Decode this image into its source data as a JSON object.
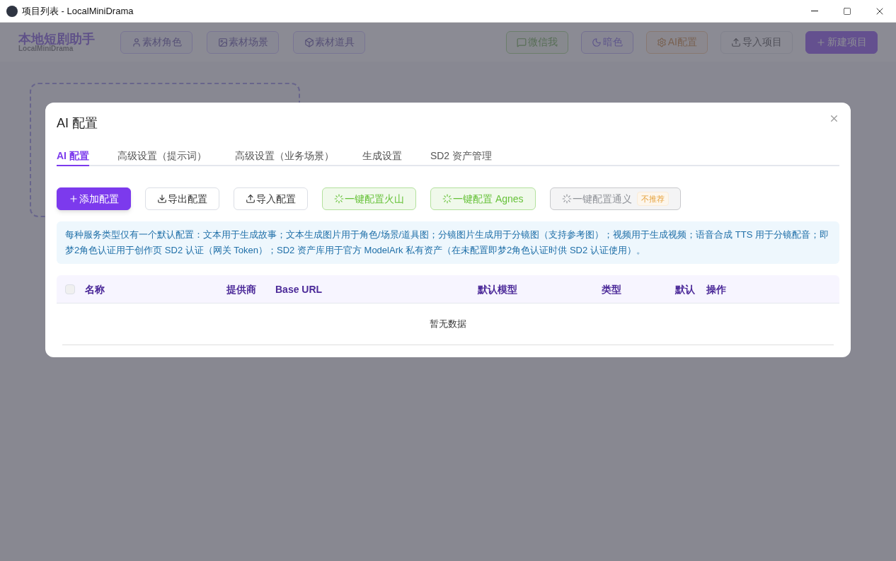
{
  "window": {
    "title": "项目列表 - LocalMiniDrama"
  },
  "header": {
    "logo": "本地短剧助手",
    "logo_sub": "LocalMiniDrama",
    "left_buttons": [
      {
        "label": "素材角色"
      },
      {
        "label": "素材场景"
      },
      {
        "label": "素材道具"
      }
    ],
    "right_buttons": [
      {
        "label": "微信我",
        "kind": "green"
      },
      {
        "label": "暗色",
        "kind": "purple"
      },
      {
        "label": "AI配置",
        "kind": "orange"
      },
      {
        "label": "导入项目",
        "kind": "plain"
      },
      {
        "label": "新建项目",
        "kind": "primary"
      }
    ]
  },
  "dialog": {
    "title": "AI 配置",
    "tabs": [
      {
        "label": "AI 配置",
        "selected": true
      },
      {
        "label": "高级设置（提示词）",
        "selected": false
      },
      {
        "label": "高级设置（业务场景）",
        "selected": false
      },
      {
        "label": "生成设置",
        "selected": false
      },
      {
        "label": "SD2 资产管理",
        "selected": false
      }
    ],
    "actions": [
      {
        "label": "添加配置",
        "kind": "primary"
      },
      {
        "label": "导出配置",
        "kind": "plain"
      },
      {
        "label": "导入配置",
        "kind": "plain"
      },
      {
        "label": "一键配置火山",
        "kind": "green"
      },
      {
        "label": "一键配置 Agnes",
        "kind": "green"
      },
      {
        "label": "一键配置通义",
        "kind": "gray",
        "tag": "不推荐"
      }
    ],
    "notice": "每种服务类型仅有一个默认配置：文本用于生成故事；文本生成图片用于角色/场景/道具图；分镜图片生成用于分镜图（支持参考图）；视频用于生成视频；语音合成 TTS 用于分镜配音；即梦2角色认证用于创作页 SD2 认证（网关 Token）；SD2 资产库用于官方 ModelArk 私有资产（在未配置即梦2角色认证时供 SD2 认证使用）。",
    "table": {
      "select_all_checked": false,
      "columns": [
        "名称",
        "提供商",
        "Base URL",
        "默认模型",
        "类型",
        "默认",
        "操作"
      ],
      "empty_text": "暂无数据"
    }
  }
}
